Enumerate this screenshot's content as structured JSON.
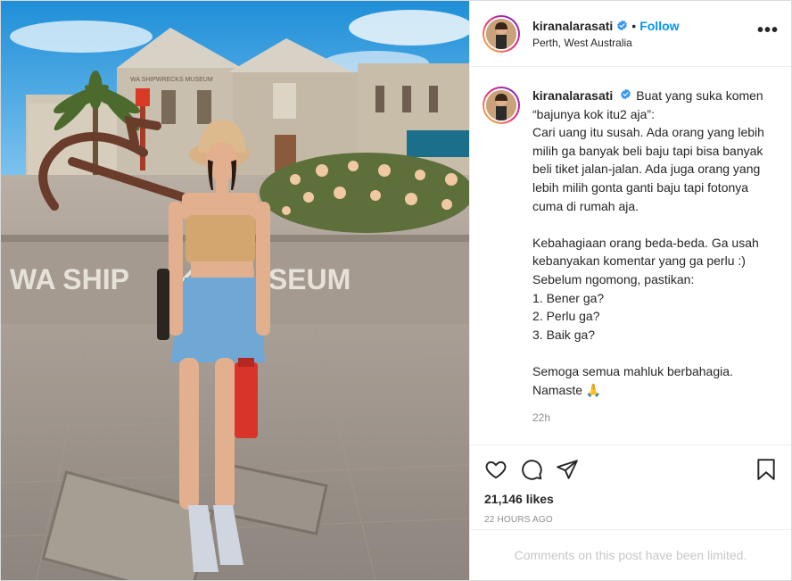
{
  "post": {
    "username": "kiranalarasati",
    "follow_label": "Follow",
    "separator": "•",
    "location": "Perth, West Australia",
    "more_label": "•••",
    "caption": "Buat yang suka komen “bajunya kok itu2 aja”:\nCari uang itu susah. Ada orang yang lebih milih ga banyak beli baju tapi bisa banyak beli tiket jalan-jalan. Ada juga orang yang lebih milih gonta ganti baju tapi fotonya cuma di rumah aja.\n\nKebahagiaan orang beda-beda. Ga usah kebanyakan komentar yang ga perlu :) Sebelum ngomong, pastikan:\n1. Bener ga?\n2. Perlu ga?\n3. Baik ga?\n\nSemoga semua mahluk berbahagia. Namaste 🙏",
    "caption_time": "22h",
    "likes": "21,146 likes",
    "posted_ago": "22 HOURS AGO",
    "comments_limited": "Comments on this post have been limited."
  },
  "photo": {
    "sign_text": "WA SHIP      KS MUSEUM",
    "building_sign": "WA SHIPWRECKS MUSEUM"
  },
  "icons": {
    "verified": "verified-badge-icon",
    "like": "heart-icon",
    "comment": "comment-icon",
    "share": "paper-plane-icon",
    "save": "bookmark-icon"
  },
  "colors": {
    "accent": "#0095f6",
    "verified": "#3897f0",
    "text": "#262626",
    "secondary": "#8e8e8e"
  }
}
